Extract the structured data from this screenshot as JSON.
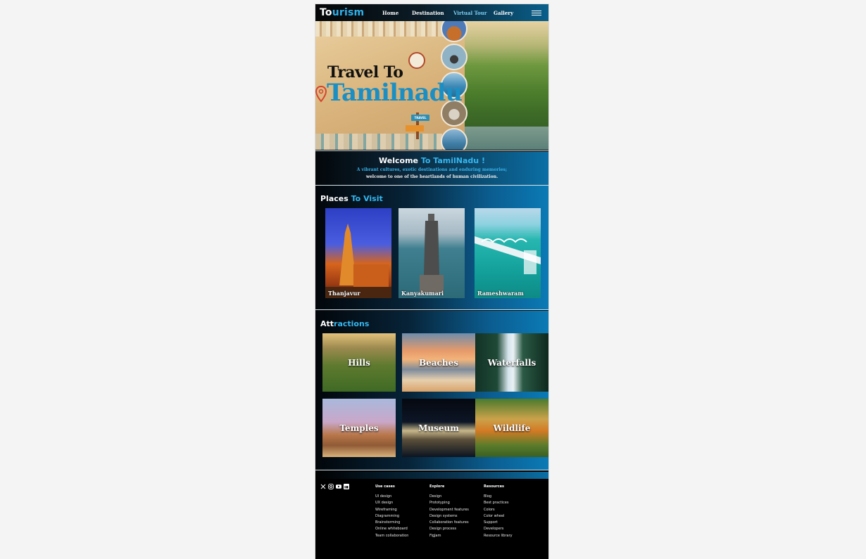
{
  "header": {
    "logo_prefix": "To",
    "logo_suffix": "urism",
    "nav": [
      "Home",
      "Destination",
      "Virtual Tour",
      "Gallery"
    ]
  },
  "hero": {
    "line1": "Travel To",
    "line2": "Tamilnadu",
    "sign_text": "TRAVEL"
  },
  "welcome": {
    "title_prefix": "Welcome",
    "title_highlight": "To TamilNadu !",
    "subtitle_line1": "A vibrant cultures, exotic destinations and enduring memories;",
    "subtitle_line2": "welcome to one of the heartlands of human civilization."
  },
  "places": {
    "title_prefix": "Places",
    "title_highlight": "To Visit",
    "items": [
      "Thanjavur",
      "Kanyakumari",
      "Rameshwaram"
    ]
  },
  "attractions": {
    "title_prefix": "Att",
    "title_highlight": "ractions",
    "items": [
      "Hills",
      "Beaches",
      "Waterfalls",
      "Temples",
      "Museum",
      "Wildlife"
    ]
  },
  "footer": {
    "social_icons": [
      "x-icon",
      "instagram-icon",
      "youtube-icon",
      "linkedin-icon"
    ],
    "columns": [
      {
        "heading": "Use cases",
        "items": [
          "UI design",
          "UX design",
          "Wireframing",
          "Diagramming",
          "Brainstorming",
          "Online whiteboard",
          "Team collaboration"
        ]
      },
      {
        "heading": "Explore",
        "items": [
          "Design",
          "Prototyping",
          "Development features",
          "Design systems",
          "Collaboration features",
          "Design process",
          "FigJam"
        ]
      },
      {
        "heading": "Resources",
        "items": [
          "Blog",
          "Best practices",
          "Colors",
          "Color wheel",
          "Support",
          "Developers",
          "Resource library"
        ]
      }
    ]
  },
  "colors": {
    "accent": "#36b6ee",
    "page_bg": "#f4f4f4",
    "frame_bg": "#000000"
  }
}
